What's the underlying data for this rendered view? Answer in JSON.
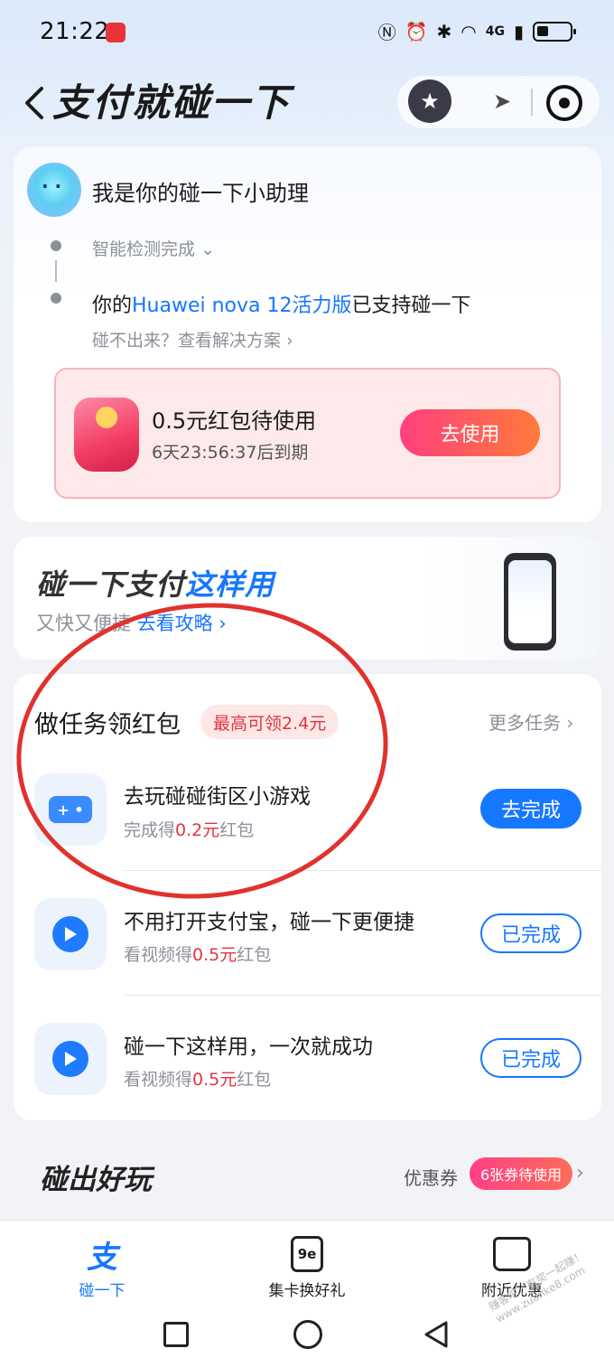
{
  "status_bar": {
    "time": "21:22",
    "network": "4G"
  },
  "header": {
    "title": "支付就碰一下"
  },
  "assistant": {
    "title": "我是你的碰一下小助理",
    "detect_status": "智能检测完成",
    "support_prefix": "你的",
    "device_model": "Huawei nova 12活力版",
    "support_suffix": "已支持碰一下",
    "solution_link": "碰不出来？查看解决方案"
  },
  "red_packet": {
    "title": "0.5元红包待使用",
    "expire": "6天23:56:37后到期",
    "button": "去使用"
  },
  "guide": {
    "title_main": "碰一下支付",
    "title_highlight": "这样用",
    "subtitle": "又快又便捷",
    "link": "去看攻略"
  },
  "tasks": {
    "title": "做任务领红包",
    "badge": "最高可领2.4元",
    "more": "更多任务",
    "items": [
      {
        "title": "去玩碰碰街区小游戏",
        "sub_prefix": "完成得",
        "reward": "0.2元",
        "sub_suffix": "红包",
        "button": "去完成",
        "icon": "gamepad-icon"
      },
      {
        "title": "不用打开支付宝，碰一下更便捷",
        "sub_prefix": "看视频得",
        "reward": "0.5元",
        "sub_suffix": "红包",
        "button": "已完成",
        "icon": "play-icon"
      },
      {
        "title": "碰一下这样用，一次就成功",
        "sub_prefix": "看视频得",
        "reward": "0.5元",
        "sub_suffix": "红包",
        "button": "已完成",
        "icon": "play-icon"
      }
    ]
  },
  "fun": {
    "title": "碰出好玩",
    "coupon_label": "优惠券",
    "coupon_count": "6张券待使用"
  },
  "tabbar": {
    "items": [
      {
        "label": "碰一下",
        "active": true
      },
      {
        "label": "集卡换好礼",
        "active": false
      },
      {
        "label": "附近优惠",
        "active": false
      }
    ]
  },
  "watermark": "赚客吧，有奖一起赚！ www.zuanke8.com",
  "colors": {
    "accent": "#1677ff",
    "reward_red": "#e0363f",
    "annotation": "#e0322e"
  }
}
